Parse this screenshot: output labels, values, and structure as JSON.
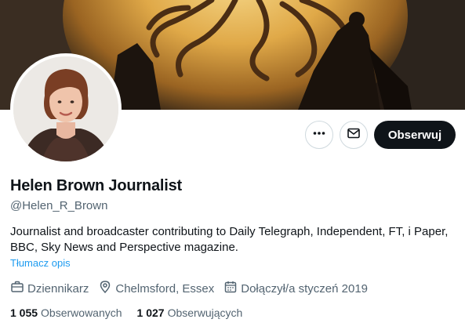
{
  "profile": {
    "display_name": "Helen Brown Journalist",
    "handle": "@Helen_R_Brown",
    "bio": "Journalist and broadcaster contributing to Daily Telegraph, Independent, FT, i Paper, BBC, Sky News and Perspective magazine.",
    "translate_label": "Tłumacz opis"
  },
  "actions": {
    "more_icon": "more-horizontal-icon",
    "message_icon": "envelope-icon",
    "follow_label": "Obserwuj"
  },
  "meta": {
    "profession": "Dziennikarz",
    "location": "Chelmsford, Essex",
    "joined": "Dołączył/a styczeń 2019"
  },
  "stats": {
    "following_count": "1 055",
    "following_label": "Obserwowanych",
    "followers_count": "1 027",
    "followers_label": "Obserwujących"
  },
  "colors": {
    "accent": "#1d9bf0",
    "secondary_text": "#536471",
    "primary_text": "#0f1419",
    "button_dark": "#0f1419"
  }
}
